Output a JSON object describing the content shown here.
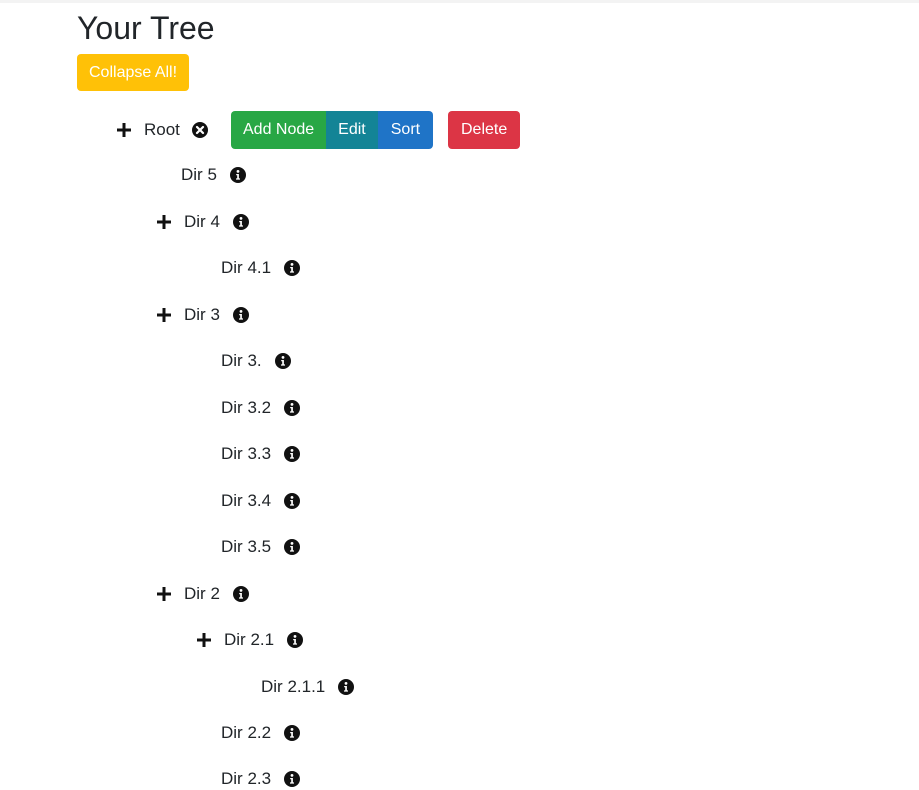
{
  "header": {
    "title": "Your Tree"
  },
  "toolbar": {
    "collapse_label": "Collapse All!"
  },
  "root": {
    "label": "Root",
    "actions": {
      "add_label": "Add Node",
      "edit_label": "Edit",
      "sort_label": "Sort",
      "delete_label": "Delete"
    }
  },
  "tree": {
    "dir5": {
      "label": "Dir 5"
    },
    "dir4": {
      "label": "Dir 4"
    },
    "dir4_1": {
      "label": "Dir 4.1"
    },
    "dir3": {
      "label": "Dir 3"
    },
    "dir3_1": {
      "label": "Dir 3."
    },
    "dir3_2": {
      "label": "Dir 3.2"
    },
    "dir3_3": {
      "label": "Dir 3.3"
    },
    "dir3_4": {
      "label": "Dir 3.4"
    },
    "dir3_5": {
      "label": "Dir 3.5"
    },
    "dir2": {
      "label": "Dir 2"
    },
    "dir2_1": {
      "label": "Dir 2.1"
    },
    "dir2_1_1": {
      "label": "Dir 2.1.1"
    },
    "dir2_2": {
      "label": "Dir 2.2"
    },
    "dir2_3": {
      "label": "Dir 2.3"
    }
  },
  "colors": {
    "warning": "#ffc107",
    "success": "#28a745",
    "info": "#138496",
    "primary": "#1f74c7",
    "danger": "#dc3545"
  },
  "icons": {
    "expand": "plus-icon",
    "info": "info-circle-icon",
    "remove": "times-circle-icon"
  }
}
